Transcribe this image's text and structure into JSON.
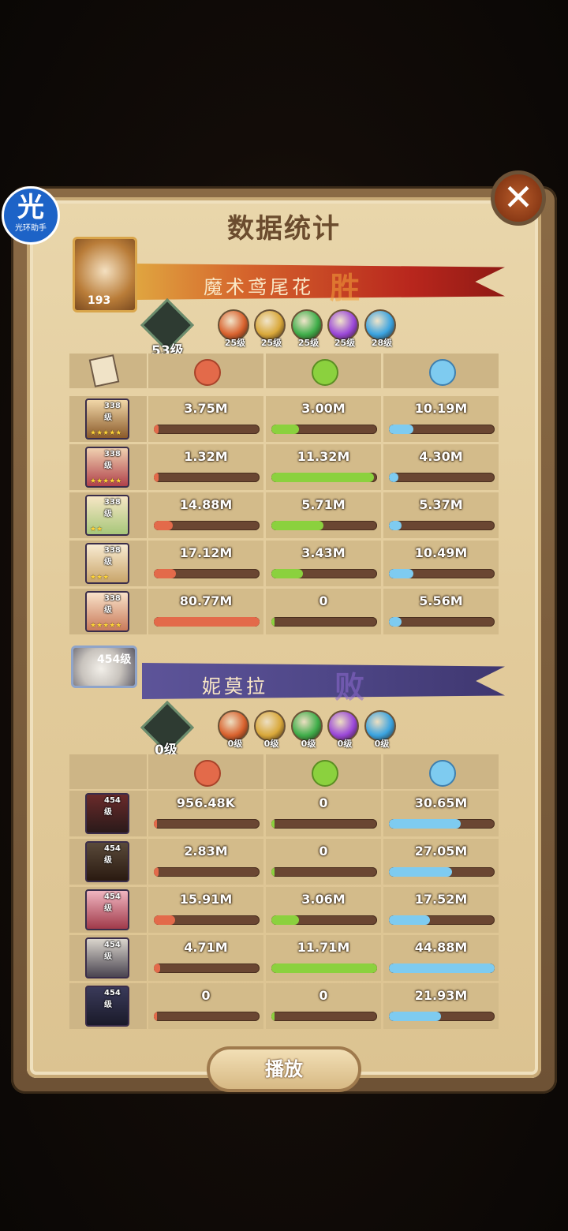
{
  "app_badge": {
    "big": "光",
    "small": "光环助手"
  },
  "title": "数据统计",
  "close_label": "✕",
  "winner": {
    "name": "魔术鸢尾花",
    "status": "胜",
    "leader_level": "193",
    "tree_level": "53级",
    "faction_levels": [
      "25级",
      "25级",
      "25级",
      "25级",
      "28级"
    ]
  },
  "loser": {
    "name": "妮莫拉",
    "status": "败",
    "leader_level": "454级",
    "tree_level": "0级",
    "faction_levels": [
      "0级",
      "0级",
      "0级",
      "0级",
      "0级"
    ]
  },
  "faction_colors": [
    "#d9622e",
    "#d9a83a",
    "#3fae4a",
    "#9a47d8",
    "#3aa3e0"
  ],
  "stat_colors": {
    "damage": "#e36a4a",
    "heal": "#8bd13e",
    "tank": "#7ecbf0"
  },
  "stat_icons": [
    "damage-icon",
    "heal-icon",
    "shield-icon"
  ],
  "team_a": [
    {
      "level": "338级",
      "stars": "★★★★★",
      "damage": "3.75M",
      "heal": "3.00M",
      "tank": "10.19M",
      "damage_pct": 0.04,
      "heal_pct": 0.26,
      "tank_pct": 0.23
    },
    {
      "level": "338级",
      "stars": "★★★★★",
      "damage": "1.32M",
      "heal": "11.32M",
      "tank": "4.30M",
      "damage_pct": 0.02,
      "heal_pct": 0.97,
      "tank_pct": 0.09
    },
    {
      "level": "338级",
      "stars": "★★",
      "damage": "14.88M",
      "heal": "5.71M",
      "tank": "5.37M",
      "damage_pct": 0.18,
      "heal_pct": 0.49,
      "tank_pct": 0.12
    },
    {
      "level": "338级",
      "stars": "★★★",
      "damage": "17.12M",
      "heal": "3.43M",
      "tank": "10.49M",
      "damage_pct": 0.21,
      "heal_pct": 0.3,
      "tank_pct": 0.23
    },
    {
      "level": "338级",
      "stars": "★★★★★",
      "damage": "80.77M",
      "heal": "0",
      "tank": "5.56M",
      "damage_pct": 1.0,
      "heal_pct": 0.0,
      "tank_pct": 0.12
    }
  ],
  "team_b": [
    {
      "level": "454级",
      "stars": "",
      "damage": "956.48K",
      "heal": "0",
      "tank": "30.65M",
      "damage_pct": 0.0,
      "heal_pct": 0.0,
      "tank_pct": 0.68
    },
    {
      "level": "454级",
      "stars": "",
      "damage": "2.83M",
      "heal": "0",
      "tank": "27.05M",
      "damage_pct": 0.03,
      "heal_pct": 0.0,
      "tank_pct": 0.6
    },
    {
      "level": "454级",
      "stars": "",
      "damage": "15.91M",
      "heal": "3.06M",
      "tank": "17.52M",
      "damage_pct": 0.2,
      "heal_pct": 0.26,
      "tank_pct": 0.39
    },
    {
      "level": "454级",
      "stars": "",
      "damage": "4.71M",
      "heal": "11.71M",
      "tank": "44.88M",
      "damage_pct": 0.06,
      "heal_pct": 1.0,
      "tank_pct": 1.0
    },
    {
      "level": "454级",
      "stars": "",
      "damage": "0",
      "heal": "0",
      "tank": "21.93M",
      "damage_pct": 0.0,
      "heal_pct": 0.0,
      "tank_pct": 0.49
    }
  ],
  "play_label": "播放"
}
